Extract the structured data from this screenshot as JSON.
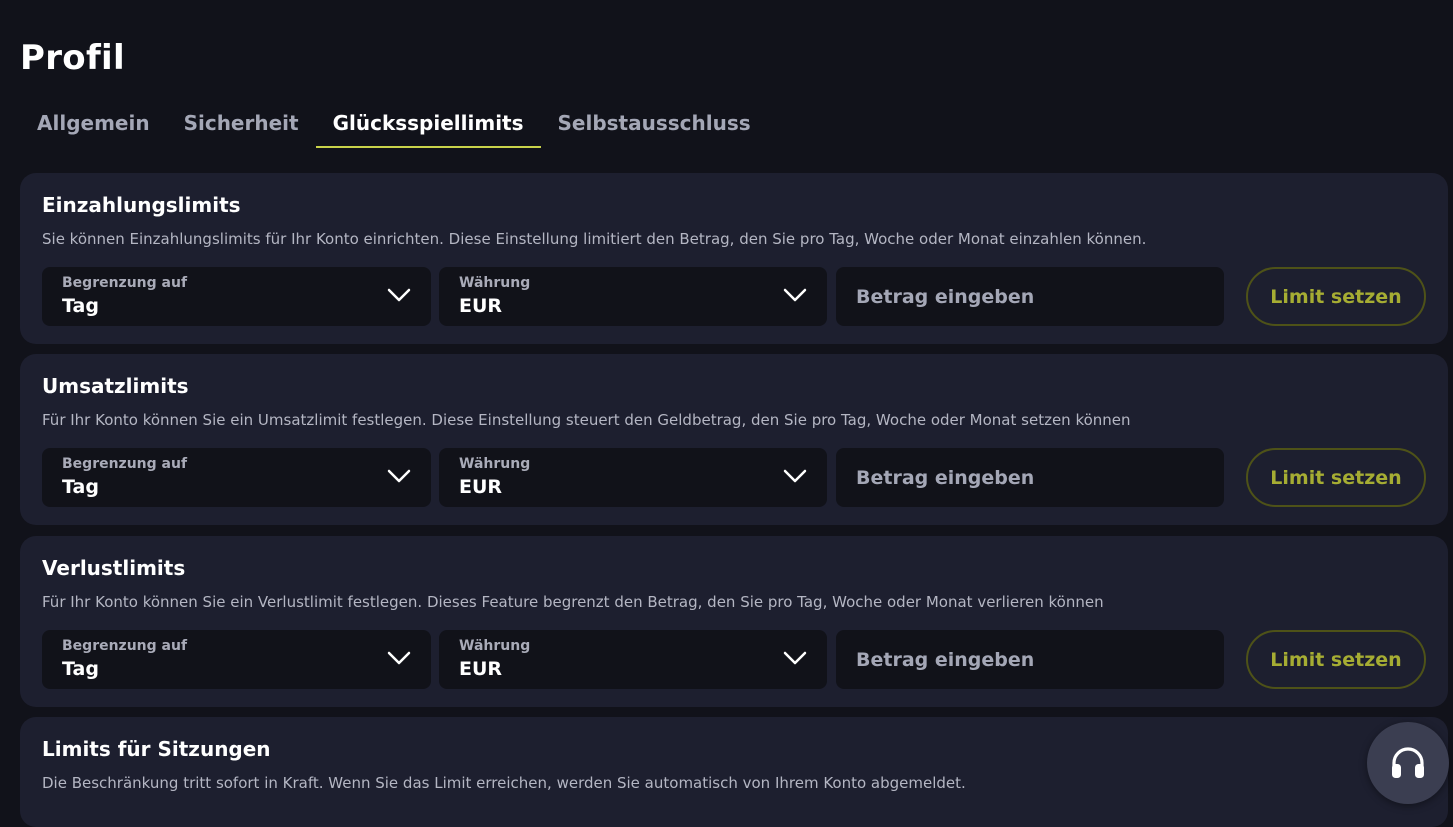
{
  "page": {
    "title": "Profil"
  },
  "tabs": [
    {
      "label": "Allgemein",
      "active": false
    },
    {
      "label": "Sicherheit",
      "active": false
    },
    {
      "label": "Glücksspiellimits",
      "active": true
    },
    {
      "label": "Selbstausschluss",
      "active": false
    }
  ],
  "sections": [
    {
      "title": "Einzahlungslimits",
      "description": "Sie können Einzahlungslimits für Ihr Konto einrichten. Diese Einstellung limitiert den Betrag, den Sie pro Tag, Woche oder Monat einzahlen können.",
      "period_label": "Begrenzung auf",
      "period_value": "Tag",
      "currency_label": "Währung",
      "currency_value": "EUR",
      "amount_placeholder": "Betrag eingeben",
      "button_label": "Limit setzen"
    },
    {
      "title": "Umsatzlimits",
      "description": "Für Ihr Konto können Sie ein Umsatzlimit festlegen. Diese Einstellung steuert den Geldbetrag, den Sie pro Tag, Woche oder Monat setzen können",
      "period_label": "Begrenzung auf",
      "period_value": "Tag",
      "currency_label": "Währung",
      "currency_value": "EUR",
      "amount_placeholder": "Betrag eingeben",
      "button_label": "Limit setzen"
    },
    {
      "title": "Verlustlimits",
      "description": "Für Ihr Konto können Sie ein Verlustlimit festlegen. Dieses Feature begrenzt den Betrag, den Sie pro Tag, Woche oder Monat verlieren können",
      "period_label": "Begrenzung auf",
      "period_value": "Tag",
      "currency_label": "Währung",
      "currency_value": "EUR",
      "amount_placeholder": "Betrag eingeben",
      "button_label": "Limit setzen"
    },
    {
      "title": "Limits für Sitzungen",
      "description": "Die Beschränkung tritt sofort in Kraft. Wenn Sie das Limit erreichen, werden Sie automatisch von Ihrem Konto abgemeldet."
    }
  ],
  "support": {
    "icon": "headset-icon"
  },
  "colors": {
    "background": "#11121a",
    "card": "#1d1f2f",
    "field": "#111219",
    "accent": "#c9d24a",
    "button_text": "#a6ad33",
    "button_border": "#4e5218"
  }
}
